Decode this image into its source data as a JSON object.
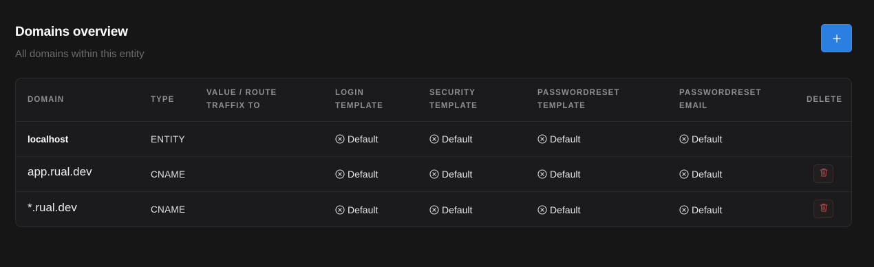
{
  "header": {
    "title": "Domains overview",
    "subtitle": "All domains within this entity",
    "add_icon": "plus-icon"
  },
  "colors": {
    "accent": "#2b7fe0",
    "background": "#161617",
    "delete_icon": "#b04a4a"
  },
  "table": {
    "columns": {
      "domain": "DOMAIN",
      "type": "TYPE",
      "value": "VALUE / ROUTE TRAFFIX TO",
      "login": "LOGIN TEMPLATE",
      "security": "SECURITY TEMPLATE",
      "pw_template": "PASSWORDRESET TEMPLATE",
      "pw_email": "PASSWORDRESET EMAIL",
      "delete": "DELETE"
    },
    "rows": [
      {
        "domain": "localhost",
        "type": "ENTITY",
        "value": "",
        "login": "Default",
        "security": "Default",
        "pw_template": "Default",
        "pw_email": "Default",
        "deletable": false
      },
      {
        "domain": "app.rual.dev",
        "type": "CNAME",
        "value": "",
        "login": "Default",
        "security": "Default",
        "pw_template": "Default",
        "pw_email": "Default",
        "deletable": true
      },
      {
        "domain": "*.rual.dev",
        "type": "CNAME",
        "value": "",
        "login": "Default",
        "security": "Default",
        "pw_template": "Default",
        "pw_email": "Default",
        "deletable": true
      }
    ]
  }
}
